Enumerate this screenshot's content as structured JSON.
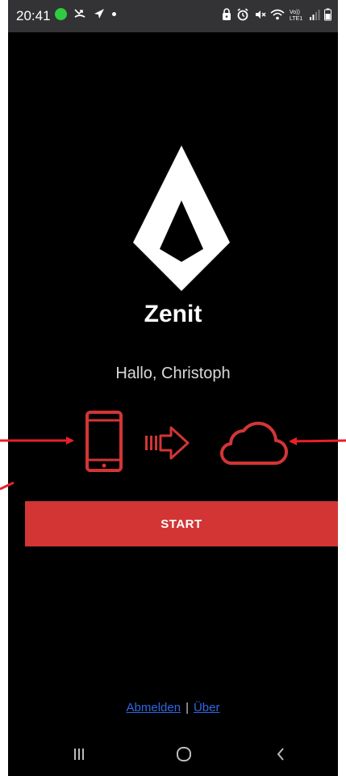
{
  "status_bar": {
    "time": "20:41",
    "network_label": "Vo))\nLTE1"
  },
  "app": {
    "brand_name": "Zenit",
    "greeting": "Hallo, Christoph",
    "start_label": "START",
    "footer": {
      "logout_label": "Abmelden",
      "separator": "|",
      "about_label": "Über"
    }
  },
  "icons": {
    "logo": "zenit-diamond-logo",
    "device": "smartphone-icon",
    "arrow": "transfer-arrow-icon",
    "cloud": "cloud-icon",
    "nav": [
      "recent-apps-icon",
      "home-icon",
      "back-icon"
    ]
  },
  "colors": {
    "accent": "#d33535",
    "background": "#000000",
    "link": "#2f67e6",
    "annotation": "#e8202a"
  }
}
